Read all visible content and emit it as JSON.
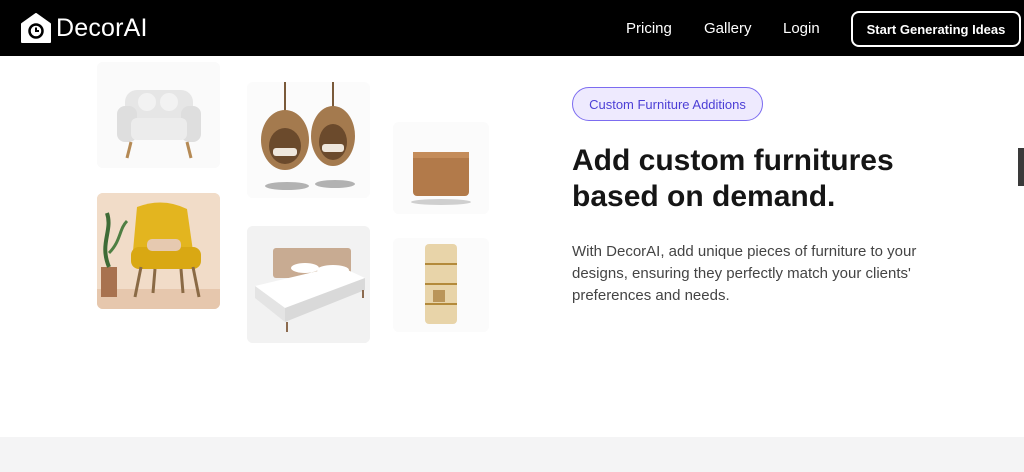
{
  "header": {
    "brand": "DecorAI",
    "nav": [
      "Pricing",
      "Gallery",
      "Login"
    ],
    "cta_label": "Start Generating Ideas"
  },
  "gallery": {
    "items": [
      "armchair-white",
      "hanging-egg-chairs",
      "wooden-cabinet",
      "armchair-yellow",
      "bed",
      "glass-shelf"
    ]
  },
  "feature": {
    "badge": "Custom Furniture Additions",
    "headline": "Add custom furnitures based on demand.",
    "description": "With DecorAI, add unique pieces of furniture to your designs, ensuring they perfectly match your clients' preferences and needs."
  },
  "colors": {
    "header_bg": "#000000",
    "badge_bg": "#eeeafe",
    "badge_border": "#7c6cf0",
    "badge_text": "#4c3fd6"
  }
}
